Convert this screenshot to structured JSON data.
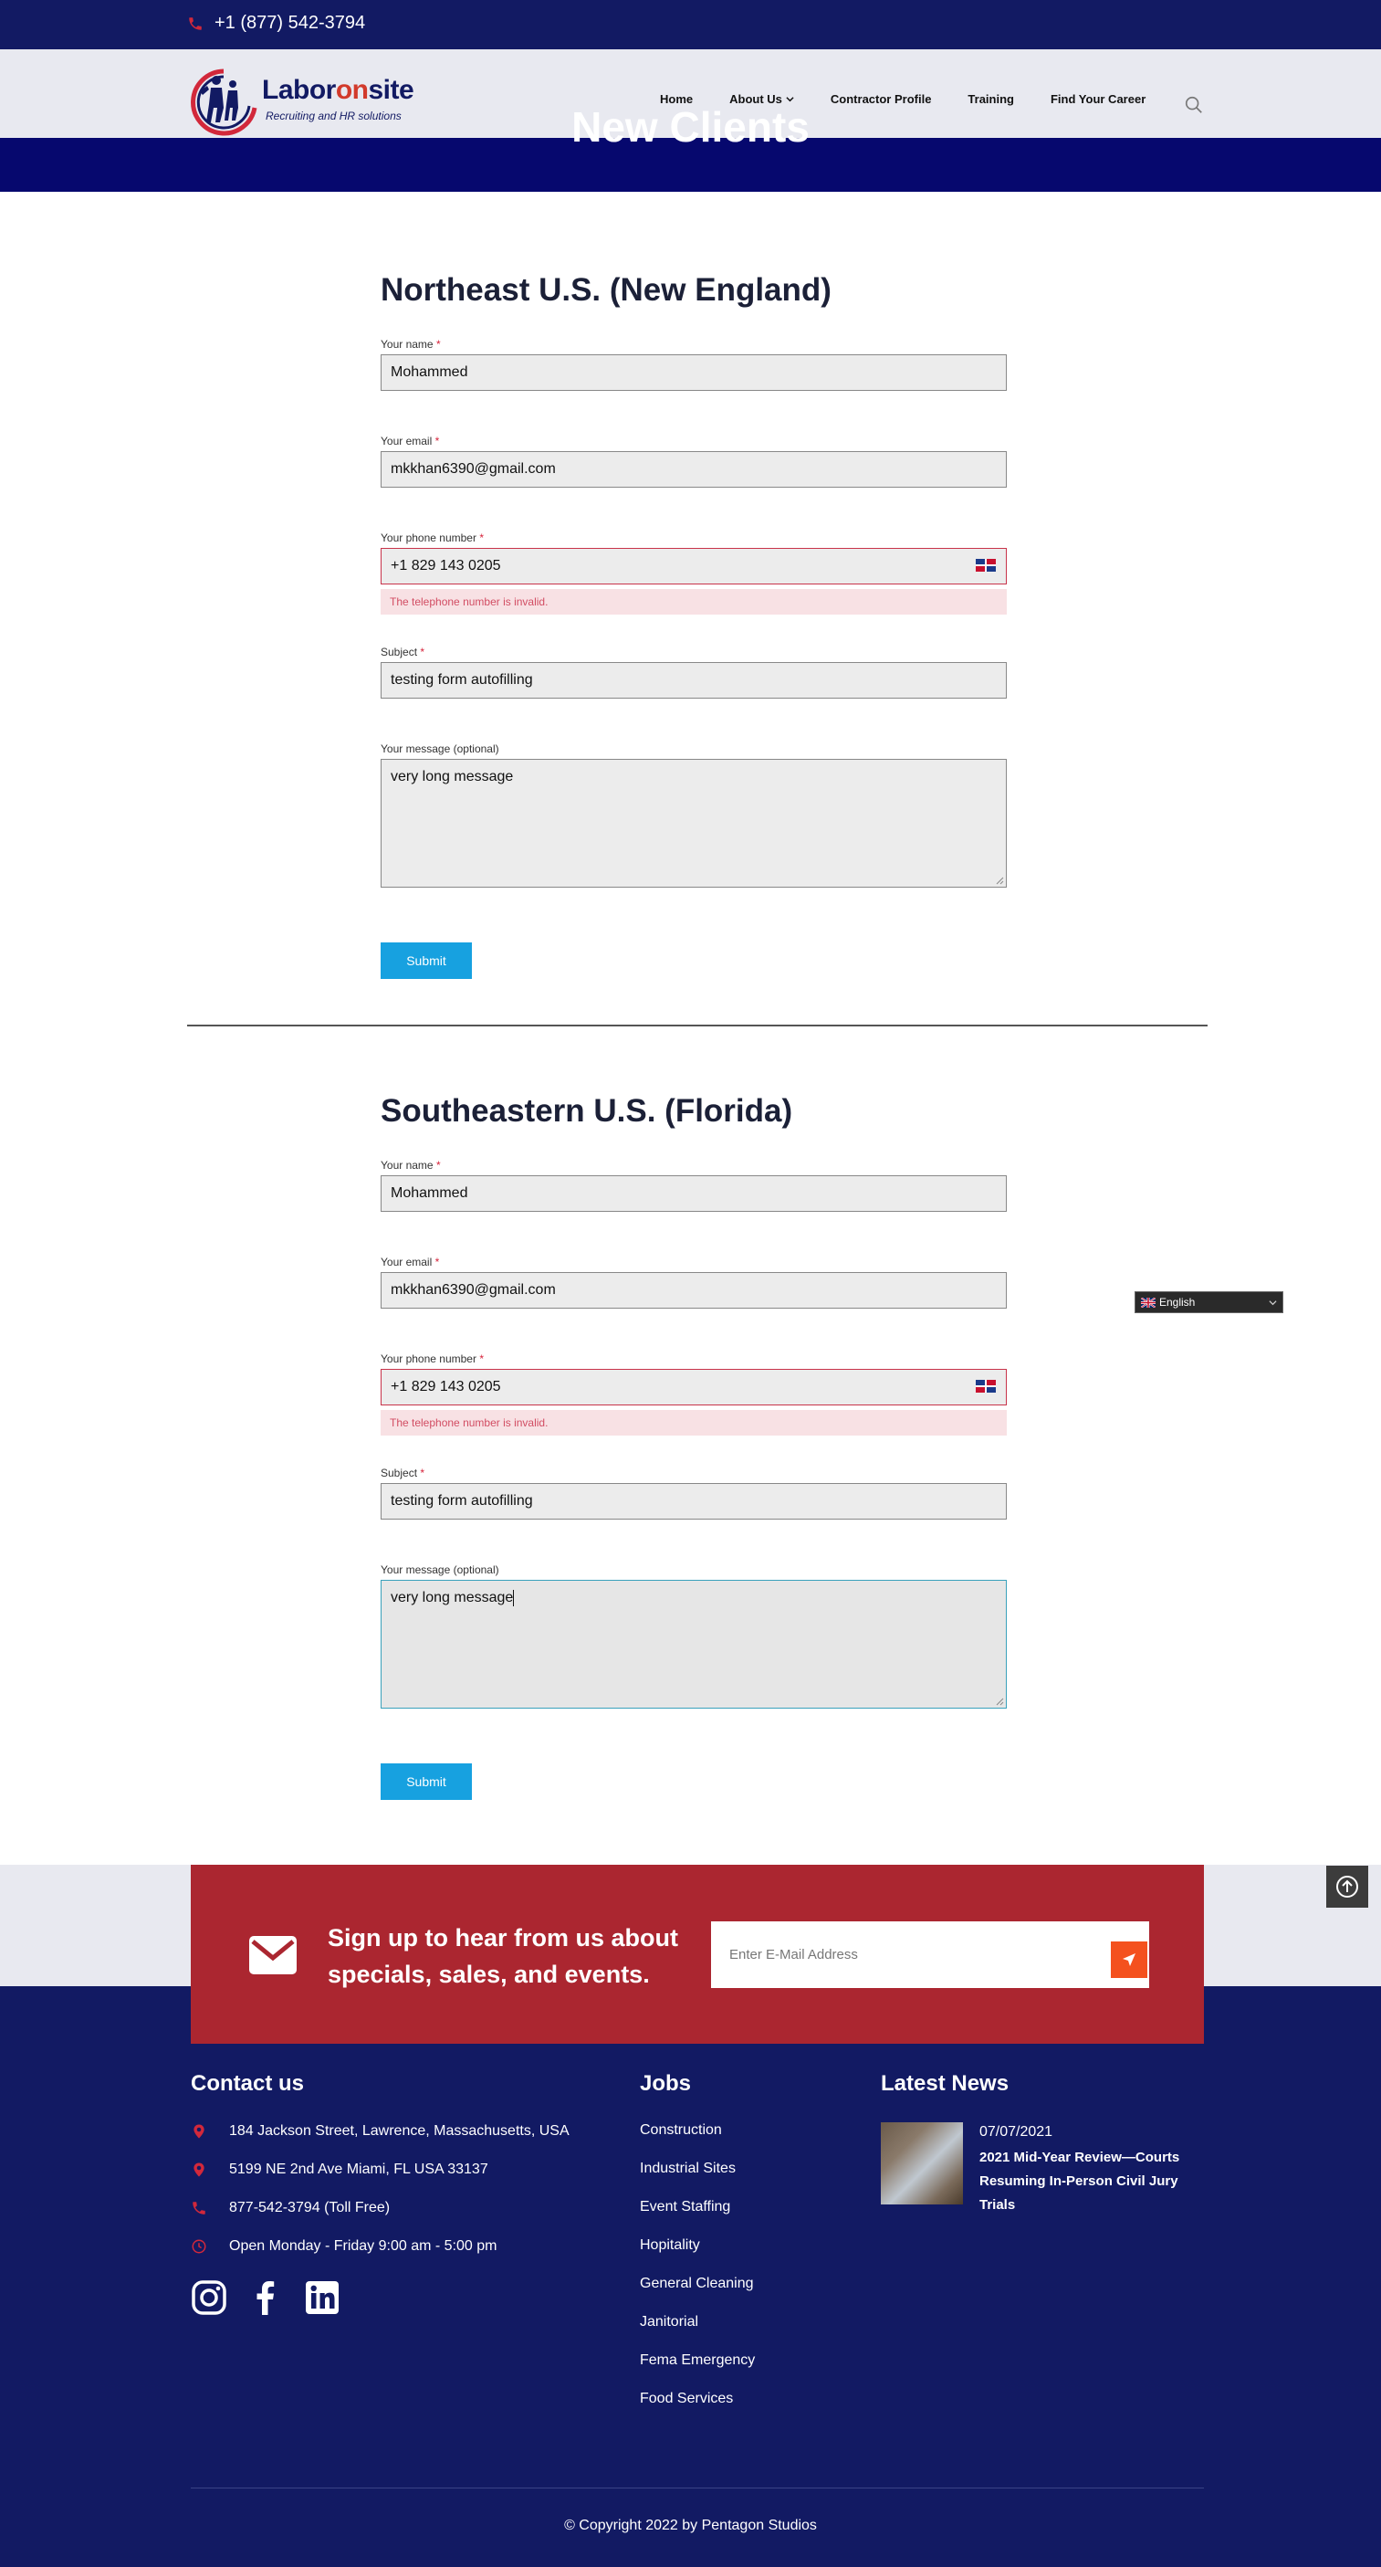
{
  "topbar": {
    "phone": "+1 (877) 542-3794"
  },
  "header": {
    "logo_brand_1": "Labor",
    "logo_brand_2": "on",
    "logo_brand_3": "site",
    "logo_tagline": "Recruiting and HR solutions",
    "nav": [
      "Home",
      "About Us",
      "Contractor Profile",
      "Training",
      "Find Your Career"
    ]
  },
  "hero": {
    "title": "New Clients"
  },
  "forms": [
    {
      "heading": "Northeast U.S. (New England)",
      "name_label": "Your name",
      "name_value": "Mohammed",
      "email_label": "Your email",
      "email_value": "mkkhan6390@gmail.com",
      "phone_label": "Your phone number",
      "phone_value": "+1 829 143 0205",
      "phone_error": "The telephone number is invalid.",
      "subject_label": "Subject",
      "subject_value": "testing form autofilling",
      "message_label": "Your message (optional)",
      "message_value": "very long message",
      "submit_label": "Submit"
    },
    {
      "heading": "Southeastern U.S. (Florida)",
      "name_label": "Your name",
      "name_value": "Mohammed",
      "email_label": "Your email",
      "email_value": "mkkhan6390@gmail.com",
      "phone_label": "Your phone number",
      "phone_value": "+1 829 143 0205",
      "phone_error": "The telephone number is invalid.",
      "subject_label": "Subject",
      "subject_value": "testing form autofilling",
      "message_label": "Your message (optional)",
      "message_value": "very long message",
      "submit_label": "Submit"
    }
  ],
  "required_mark": "*",
  "translate": {
    "language": "English"
  },
  "newsletter": {
    "text": "Sign up to hear from us about specials, sales, and events.",
    "placeholder": "Enter E-Mail Address"
  },
  "footer": {
    "contact_heading": "Contact us",
    "contact": [
      "184 Jackson Street, Lawrence, Massachusetts, USA",
      "5199 NE 2nd Ave Miami, FL USA 33137",
      "877-542-3794 (Toll Free)",
      "Open Monday - Friday 9:00 am - 5:00 pm"
    ],
    "jobs_heading": "Jobs",
    "jobs": [
      "Construction",
      "Industrial Sites",
      "Event Staffing",
      "Hopitality",
      "General Cleaning",
      "Janitorial",
      "Fema Emergency",
      "Food Services"
    ],
    "news_heading": "Latest News",
    "news_date": "07/07/2021",
    "news_title": "2021 Mid-Year Review—Courts Resuming In-Person Civil Jury Trials",
    "copyright_prefix": "© Copyright 2022 by ",
    "copyright_company": "Pentagon Studios"
  },
  "colors": {
    "navy": "#121a63",
    "hero_blue": "#06086e",
    "accent_red": "#ab2630",
    "submit_blue": "#17a1e0",
    "send_orange": "#f4511e",
    "error_pink": "#f8e1e4"
  }
}
